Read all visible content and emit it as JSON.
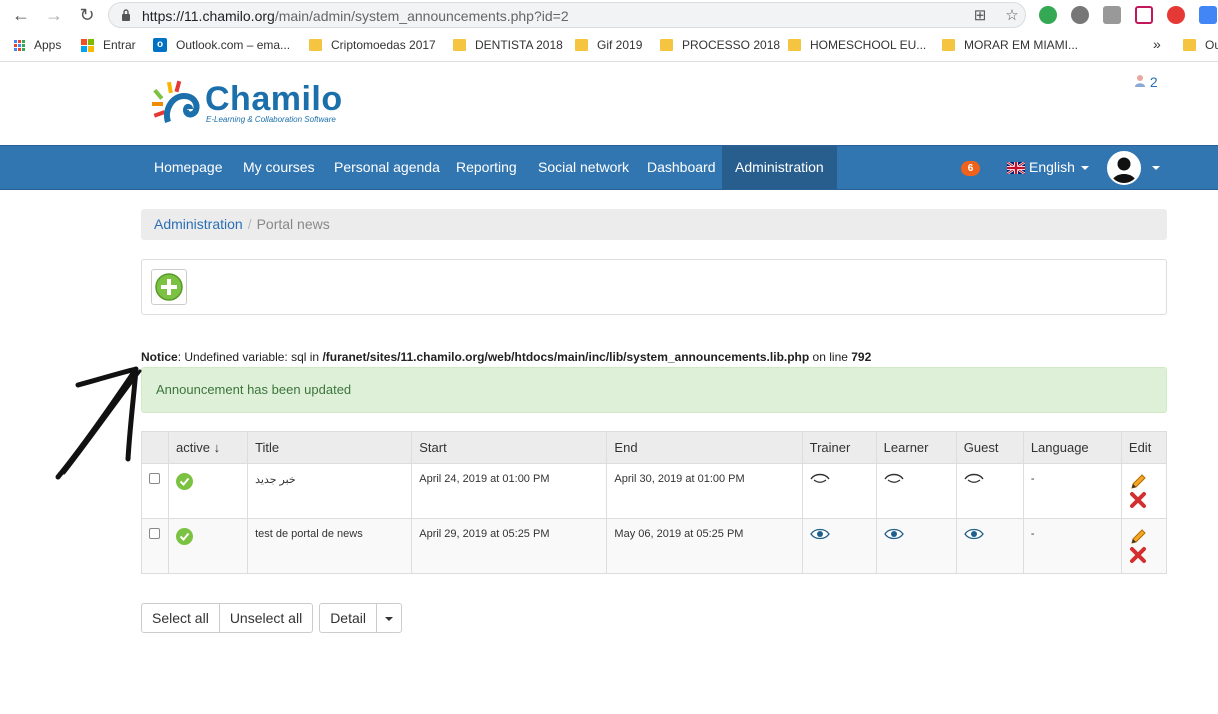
{
  "browser": {
    "url_host": "https://11.chamilo.org",
    "url_path": "/main/admin/system_announcements.php?id=2"
  },
  "bookmarks": [
    {
      "label": "Apps",
      "icon": "apps-icon"
    },
    {
      "label": "Entrar",
      "icon": "microsoft-icon"
    },
    {
      "label": "Outlook.com – ema...",
      "icon": "outlook-icon"
    },
    {
      "label": "Criptomoedas 2017",
      "icon": "folder-icon"
    },
    {
      "label": "DENTISTA 2018",
      "icon": "folder-icon"
    },
    {
      "label": "Gif 2019",
      "icon": "folder-icon"
    },
    {
      "label": "PROCESSO 2018",
      "icon": "folder-icon"
    },
    {
      "label": "HOMESCHOOL EU...",
      "icon": "folder-icon"
    },
    {
      "label": "MORAR EM MIAMI...",
      "icon": "folder-icon"
    }
  ],
  "bookmarks_more": "»",
  "bookmarks_other": "Ou",
  "logo": {
    "title": "Chamilo",
    "subtitle": "E-Learning & Collaboration Software"
  },
  "header": {
    "online_users": "2"
  },
  "nav": {
    "items": [
      "Homepage",
      "My courses",
      "Personal agenda",
      "Reporting",
      "Social network",
      "Dashboard",
      "Administration"
    ],
    "notifications": "6",
    "language": "English"
  },
  "breadcrumb": {
    "parent": "Administration",
    "separator": "/",
    "current": "Portal news"
  },
  "notice": {
    "label": "Notice",
    "text": ": Undefined variable: sql in ",
    "file": "/furanet/sites/11.chamilo.org/web/htdocs/main/inc/lib/system_announcements.lib.php",
    "online": " on line ",
    "line": "792"
  },
  "alert": {
    "text": "Announcement has been updated"
  },
  "table": {
    "headers": {
      "active": "active ↓",
      "title": "Title",
      "start": "Start",
      "end": "End",
      "trainer": "Trainer",
      "learner": "Learner",
      "guest": "Guest",
      "language": "Language",
      "edit": "Edit"
    },
    "rows": [
      {
        "title": "خبر جديد",
        "start": "April 24, 2019 at 01:00 PM",
        "end": "April 30, 2019 at 01:00 PM",
        "language": "-"
      },
      {
        "title": "test de portal de news",
        "start": "April 29, 2019 at 05:25 PM",
        "end": "May 06, 2019 at 05:25 PM",
        "language": "-"
      }
    ]
  },
  "actions": {
    "select_all": "Select all",
    "unselect_all": "Unselect all",
    "detail": "Detail"
  },
  "colors": {
    "navbar": "#3276b1",
    "navbar_active": "#285e8e",
    "success_bg": "#dff0d8",
    "success_text": "#3c763d",
    "link": "#2a6fb6"
  }
}
